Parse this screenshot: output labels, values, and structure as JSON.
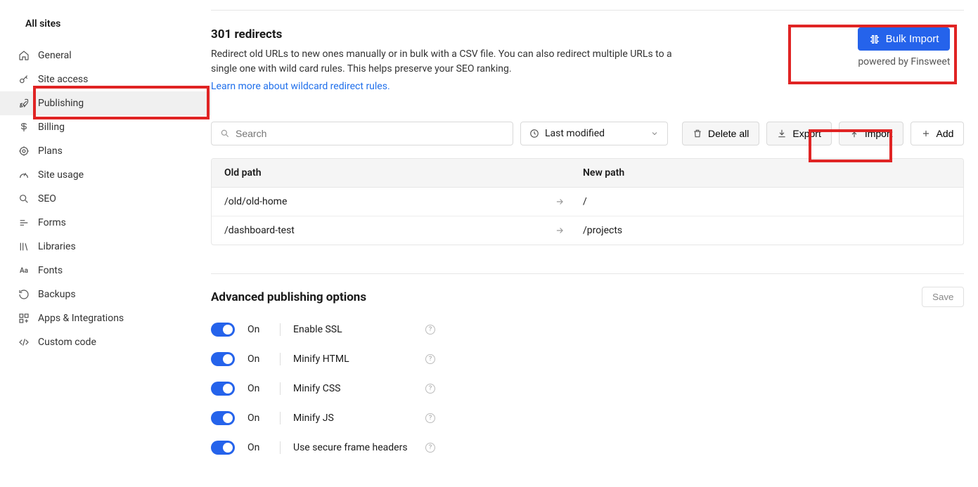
{
  "sidebar": {
    "all_sites": "All sites",
    "items": [
      {
        "label": "General"
      },
      {
        "label": "Site access"
      },
      {
        "label": "Publishing"
      },
      {
        "label": "Billing"
      },
      {
        "label": "Plans"
      },
      {
        "label": "Site usage"
      },
      {
        "label": "SEO"
      },
      {
        "label": "Forms"
      },
      {
        "label": "Libraries"
      },
      {
        "label": "Fonts"
      },
      {
        "label": "Backups"
      },
      {
        "label": "Apps & Integrations"
      },
      {
        "label": "Custom code"
      }
    ]
  },
  "redirects": {
    "title": "301 redirects",
    "desc": "Redirect old URLs to new ones manually or in bulk with a CSV file. You can also redirect multiple URLs to a single one with wild card rules. This helps preserve your SEO ranking.",
    "learn_more": "Learn more about wildcard redirect rules.",
    "bulk_import": "Bulk Import",
    "powered": "powered by Finsweet",
    "search_placeholder": "Search",
    "sort_label": "Last modified",
    "delete_all": "Delete all",
    "export": "Export",
    "import": "Import",
    "add": "Add",
    "col_old": "Old path",
    "col_new": "New path",
    "rows": [
      {
        "old": "/old/old-home",
        "new": "/"
      },
      {
        "old": "/dashboard-test",
        "new": "/projects"
      }
    ]
  },
  "advanced": {
    "title": "Advanced publishing options",
    "save": "Save",
    "on_label": "On",
    "options": [
      {
        "label": "Enable SSL"
      },
      {
        "label": "Minify HTML"
      },
      {
        "label": "Minify CSS"
      },
      {
        "label": "Minify JS"
      },
      {
        "label": "Use secure frame headers"
      }
    ]
  }
}
